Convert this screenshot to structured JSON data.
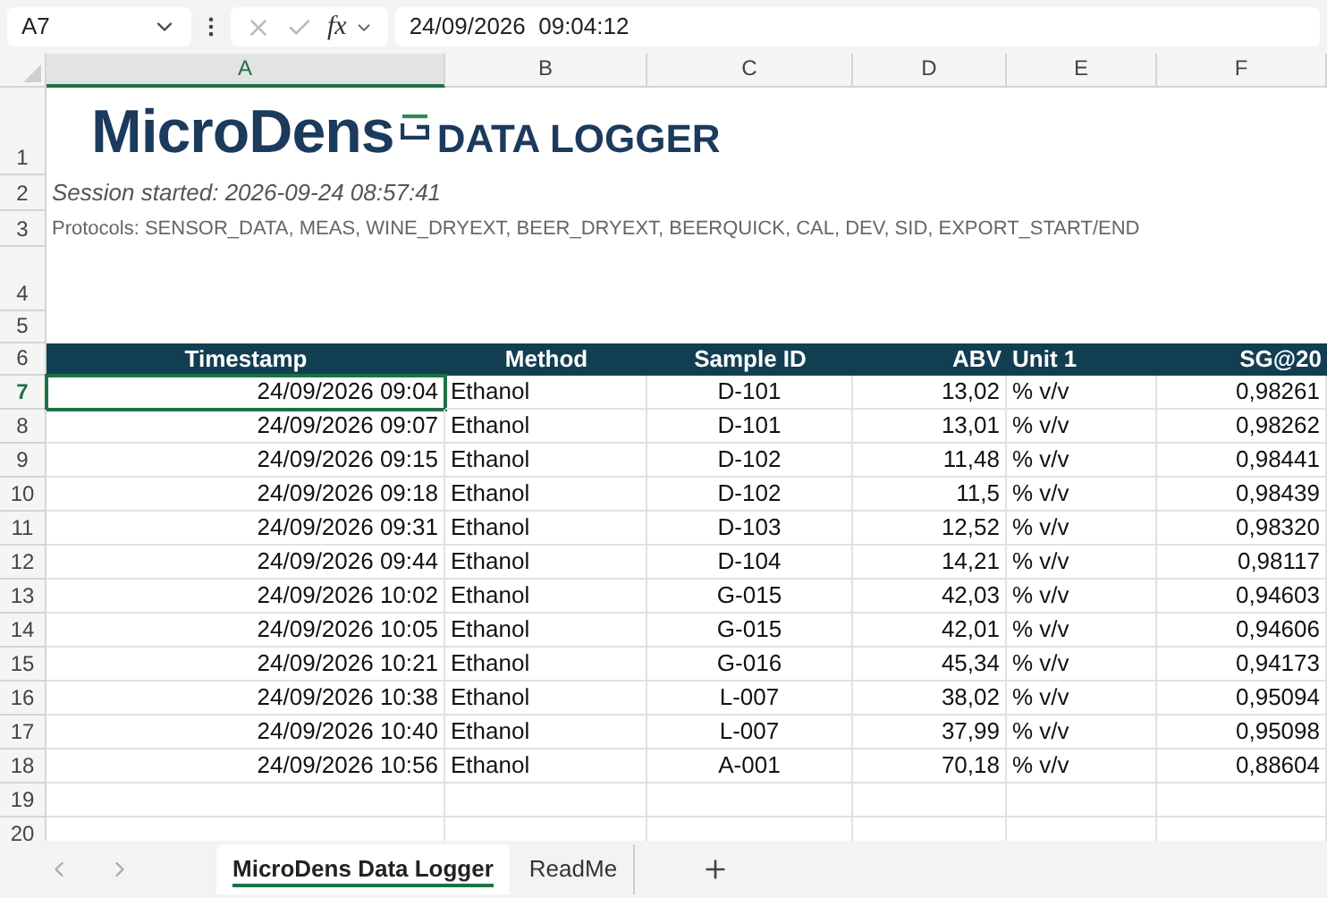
{
  "formula_bar": {
    "name_box": "A7",
    "function_label": "fx",
    "value": "24/09/2026  09:04:12"
  },
  "columns": [
    {
      "label": "A",
      "selected": true
    },
    {
      "label": "B",
      "selected": false
    },
    {
      "label": "C",
      "selected": false
    },
    {
      "label": "D",
      "selected": false
    },
    {
      "label": "E",
      "selected": false
    },
    {
      "label": "F",
      "selected": false
    }
  ],
  "logo": {
    "brand": "MicroDens",
    "product": "DATA LOGGER"
  },
  "session_text": "Session started: 2026-09-24 08:57:41",
  "protocols_text": "Protocols: SENSOR_DATA, MEAS, WINE_DRYEXT, BEER_DRYEXT, BEERQUICK, CAL, DEV, SID, EXPORT_START/END",
  "top_row_numbers": [
    "1",
    "2",
    "3",
    "4",
    "5",
    "6"
  ],
  "table": {
    "headers": [
      "Timestamp",
      "Method",
      "Sample ID",
      "ABV",
      "Unit 1",
      "SG@20"
    ],
    "rows": [
      {
        "number": "7",
        "selected": true,
        "cells": [
          "24/09/2026 09:04",
          "Ethanol",
          "D-101",
          "13,02",
          "% v/v",
          "0,98261"
        ]
      },
      {
        "number": "8",
        "selected": false,
        "cells": [
          "24/09/2026 09:07",
          "Ethanol",
          "D-101",
          "13,01",
          "% v/v",
          "0,98262"
        ]
      },
      {
        "number": "9",
        "selected": false,
        "cells": [
          "24/09/2026 09:15",
          "Ethanol",
          "D-102",
          "11,48",
          "% v/v",
          "0,98441"
        ]
      },
      {
        "number": "10",
        "selected": false,
        "cells": [
          "24/09/2026 09:18",
          "Ethanol",
          "D-102",
          "11,5",
          "% v/v",
          "0,98439"
        ]
      },
      {
        "number": "11",
        "selected": false,
        "cells": [
          "24/09/2026 09:31",
          "Ethanol",
          "D-103",
          "12,52",
          "% v/v",
          "0,98320"
        ]
      },
      {
        "number": "12",
        "selected": false,
        "cells": [
          "24/09/2026 09:44",
          "Ethanol",
          "D-104",
          "14,21",
          "% v/v",
          "0,98117"
        ]
      },
      {
        "number": "13",
        "selected": false,
        "cells": [
          "24/09/2026 10:02",
          "Ethanol",
          "G-015",
          "42,03",
          "% v/v",
          "0,94603"
        ]
      },
      {
        "number": "14",
        "selected": false,
        "cells": [
          "24/09/2026 10:05",
          "Ethanol",
          "G-015",
          "42,01",
          "% v/v",
          "0,94606"
        ]
      },
      {
        "number": "15",
        "selected": false,
        "cells": [
          "24/09/2026 10:21",
          "Ethanol",
          "G-016",
          "45,34",
          "% v/v",
          "0,94173"
        ]
      },
      {
        "number": "16",
        "selected": false,
        "cells": [
          "24/09/2026 10:38",
          "Ethanol",
          "L-007",
          "38,02",
          "% v/v",
          "0,95094"
        ]
      },
      {
        "number": "17",
        "selected": false,
        "cells": [
          "24/09/2026 10:40",
          "Ethanol",
          "L-007",
          "37,99",
          "% v/v",
          "0,95098"
        ]
      },
      {
        "number": "18",
        "selected": false,
        "cells": [
          "24/09/2026 10:56",
          "Ethanol",
          "A-001",
          "70,18",
          "% v/v",
          "0,88604"
        ]
      }
    ]
  },
  "empty_row_numbers": [
    "19",
    "20"
  ],
  "sheet_tabs": [
    {
      "label": "MicroDens Data Logger",
      "selected": true
    },
    {
      "label": "ReadMe",
      "selected": false
    }
  ]
}
